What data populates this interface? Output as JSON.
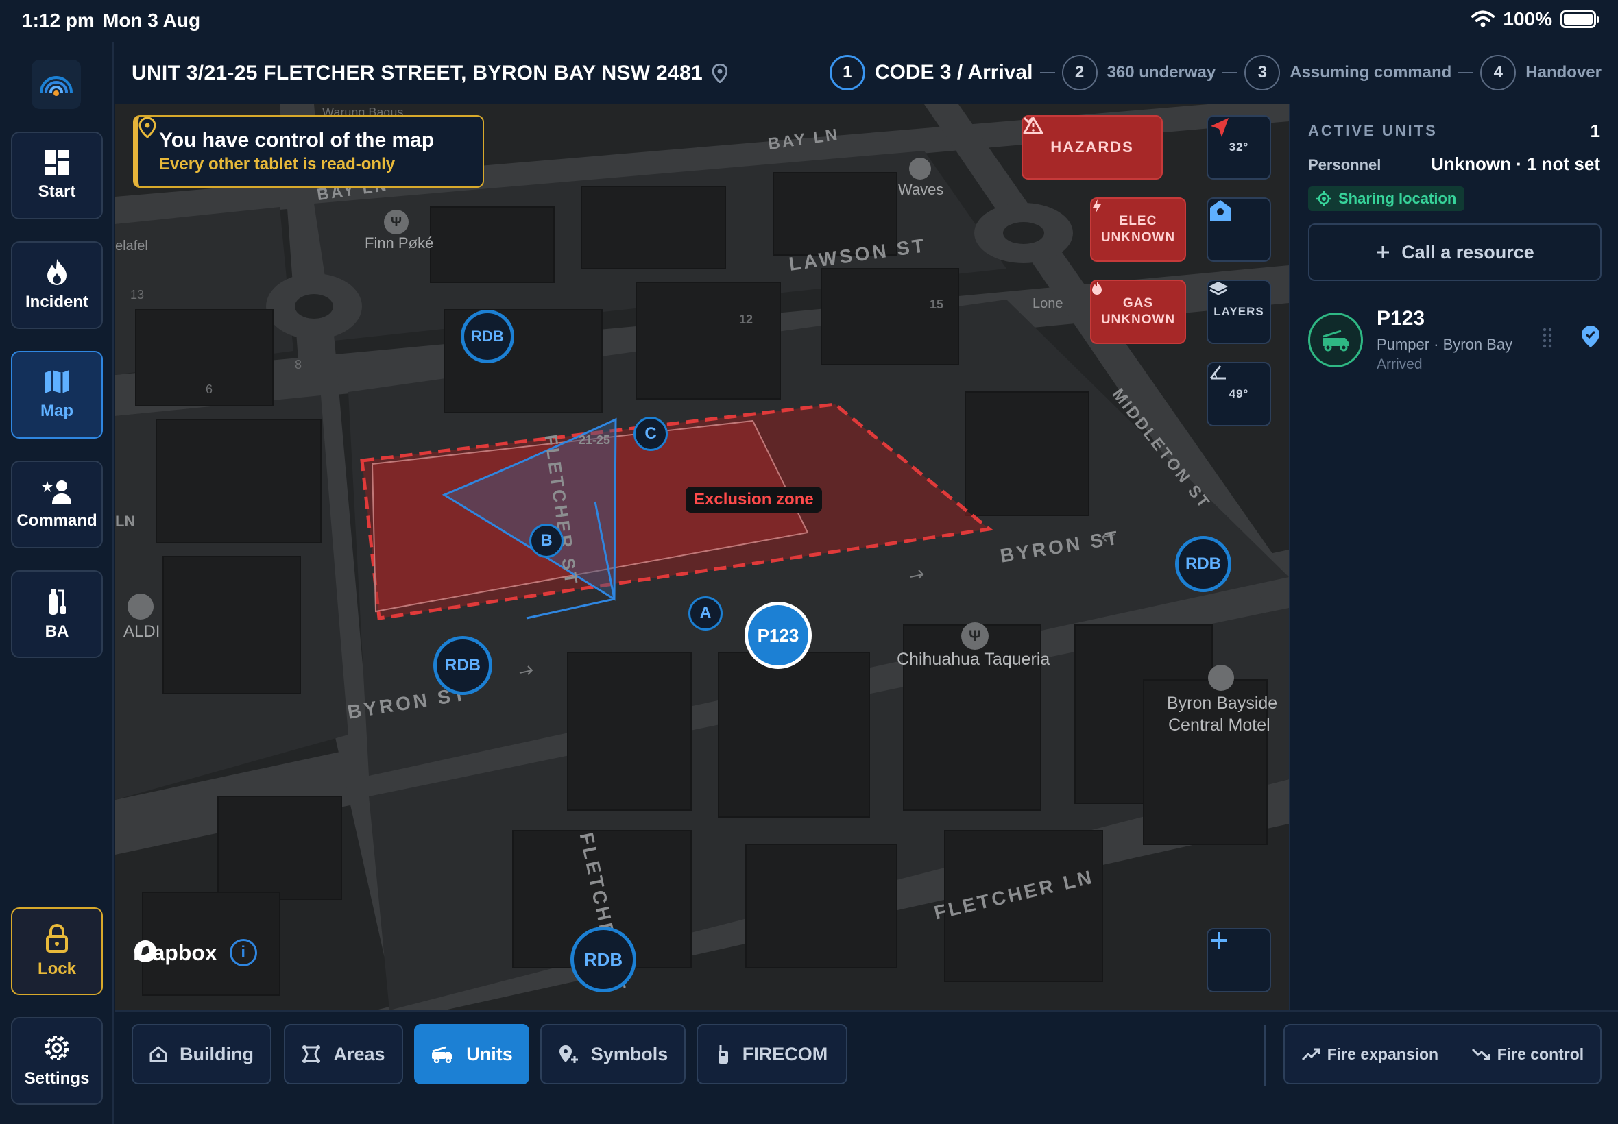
{
  "status_bar": {
    "time": "1:12 pm",
    "date": "Mon 3 Aug",
    "battery": "100%"
  },
  "rail": {
    "items": [
      {
        "label": "Start",
        "icon": "grid-icon"
      },
      {
        "label": "Incident",
        "icon": "flame-icon"
      },
      {
        "label": "Map",
        "icon": "map-icon",
        "active": true
      },
      {
        "label": "Command",
        "icon": "command-icon"
      },
      {
        "label": "BA",
        "icon": "air-cylinder-icon"
      }
    ],
    "lock_label": "Lock",
    "settings_label": "Settings"
  },
  "header": {
    "address": "UNIT 3/21-25 FLETCHER STREET, BYRON BAY NSW 2481",
    "steps": [
      {
        "num": "1",
        "label": "CODE 3 / Arrival",
        "current": true
      },
      {
        "num": "2",
        "label": "360 underway"
      },
      {
        "num": "3",
        "label": "Assuming command"
      },
      {
        "num": "4",
        "label": "Handover"
      }
    ]
  },
  "map": {
    "toast_title": "You have control of the map",
    "toast_subtitle": "Every other tablet is read-only",
    "hazards_label": "HAZARDS",
    "elec_line1": "ELEC",
    "elec_line2": "UNKNOWN",
    "gas_line1": "GAS",
    "gas_line2": "UNKNOWN",
    "compass_value": "32°",
    "layers_label": "LAYERS",
    "pitch_value": "49°",
    "exclusion_label": "Exclusion zone",
    "unit_marker": "P123",
    "rdb_label": "RDB",
    "sides": [
      "A",
      "B",
      "C"
    ],
    "streets": [
      "BAY LN",
      "BAY LN",
      "LAWSON ST",
      "FLETCHER ST",
      "FLETCHER ST",
      "BYRON ST",
      "BYRON ST",
      "MIDDLETON ST",
      "FLETCHER LN"
    ],
    "pois": [
      "Waves",
      "Finn Pøké",
      "ALDI",
      "Chihuahua Taqueria",
      "Byron Bayside",
      "Central Motel",
      "Lone",
      "Warung Bagus",
      "elafel",
      "LN"
    ],
    "building_numbers": [
      "21-25",
      "12",
      "15",
      "13",
      "8",
      "6"
    ],
    "attribution": "mapbox",
    "colors": {
      "exclusion": "#e03a3a",
      "unit": "#1c80d4",
      "hazard": "#a72828"
    }
  },
  "panel": {
    "heading": "ACTIVE UNITS",
    "count": "1",
    "personnel_label": "Personnel",
    "personnel_value": "Unknown · 1 not set",
    "sharing_label": "Sharing location",
    "call_label": "Call a resource",
    "units": [
      {
        "name": "P123",
        "type": "Pumper · Byron Bay",
        "status": "Arrived"
      }
    ]
  },
  "toolbar": {
    "tabs": [
      {
        "label": "Building",
        "icon": "house-icon"
      },
      {
        "label": "Areas",
        "icon": "area-icon"
      },
      {
        "label": "Units",
        "icon": "truck-icon",
        "active": true
      },
      {
        "label": "Symbols",
        "icon": "pin-plus-icon"
      },
      {
        "label": "FIRECOM",
        "icon": "radio-icon"
      }
    ],
    "fire_expansion": "Fire expansion",
    "fire_control": "Fire control"
  }
}
